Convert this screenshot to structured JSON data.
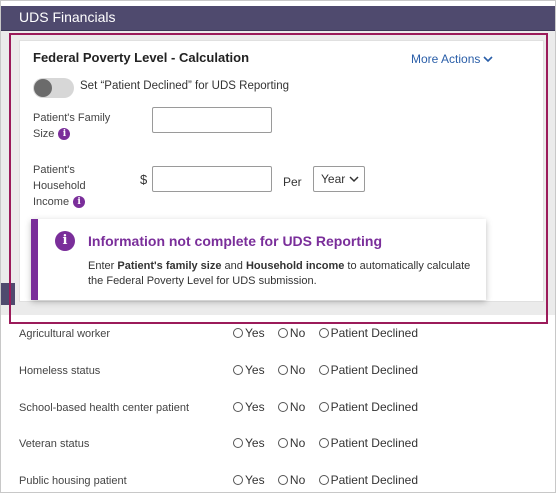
{
  "header": {
    "title": "UDS Financials"
  },
  "calculation": {
    "title": "Federal Poverty Level - Calculation",
    "more_actions_label": "More Actions",
    "toggle_label": "Set “Patient Declined” for UDS Reporting",
    "toggle_on": false,
    "family_size_label_line1": "Patient's Family",
    "family_size_label_line2": "Size",
    "family_size_value": "",
    "household_income_label_line1": "Patient's",
    "household_income_label_line2": "Household",
    "household_income_label_line3": "Income",
    "currency_symbol": "$",
    "household_income_value": "",
    "per_label": "Per",
    "period_selected": "Year"
  },
  "notice": {
    "title": "Information not complete for UDS Reporting",
    "body_part1": "Enter ",
    "body_bold1": "Patient's family size",
    "body_part2": " and ",
    "body_bold2": "Household income",
    "body_part3": " to automatically calculate the Federal Poverty Level for UDS submission."
  },
  "radio_options": {
    "yes": "Yes",
    "no": "No",
    "declined": "Patient Declined"
  },
  "rows": [
    {
      "label": "Agricultural worker"
    },
    {
      "label": "Homeless status"
    },
    {
      "label": "School-based health center patient"
    },
    {
      "label": "Veteran status"
    },
    {
      "label": "Public housing patient"
    }
  ],
  "colors": {
    "header_bg": "#4f4a6e",
    "accent_purple": "#7a2e9a",
    "highlight_border": "#9b1b5a",
    "link_blue": "#2a5ea8"
  }
}
